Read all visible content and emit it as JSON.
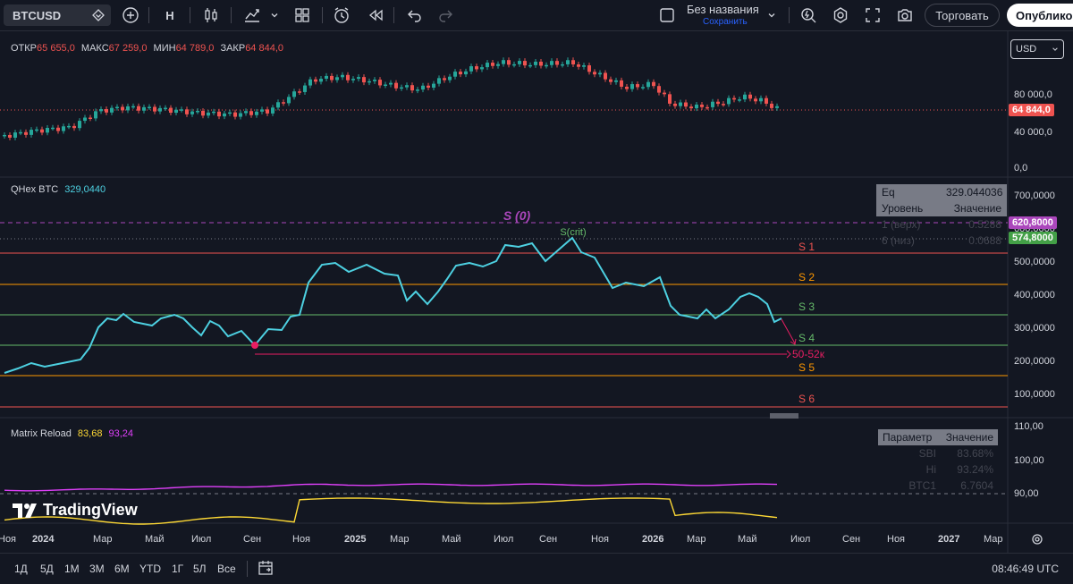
{
  "toolbar": {
    "symbol": "BTCUSD",
    "interval": "H",
    "title": "Без названия",
    "subtitle": "Сохранить",
    "trade_label": "Торговать",
    "publish_label": "Опубликовать"
  },
  "ohlc": {
    "o_label": "ОТКР",
    "o_value": "65 655,0",
    "h_label": "МАКС",
    "h_value": "67 259,0",
    "l_label": "МИН",
    "l_value": "64 789,0",
    "c_label": "ЗАКР",
    "c_value": "64 844,0"
  },
  "currency": "USD",
  "price_axis": {
    "p1": "80 000,0",
    "p2": "40 000,0",
    "p3": "0,0",
    "last_price": "64 844,0"
  },
  "qhex": {
    "name": "QHex BTC",
    "value": "329,0440",
    "axis": [
      "700,0000",
      "600,0000",
      "500,0000",
      "400,0000",
      "300,0000",
      "200,0000",
      "100,0000"
    ],
    "tag1": "620,8000",
    "tag2": "574,8000",
    "table": {
      "eq_label": "Eq",
      "eq_value": "329.044036",
      "level_h": "Уровень",
      "value_h": "Значение",
      "r1_label": "1 (верх)",
      "r1_value": "0.5288",
      "r2_label": "6 (низ)",
      "r2_value": "0.0688"
    },
    "levels": {
      "s0": "S (0)",
      "scrit": "S(crit)",
      "s1": "S 1",
      "s2": "S 2",
      "s3": "S 3",
      "s4": "S 4",
      "s5": "S 5",
      "s6": "S 6",
      "target": "50-52к"
    }
  },
  "matrix": {
    "name": "Matrix Reload",
    "v1": "83,68",
    "v2": "93,24",
    "axis": [
      "110,00",
      "100,00",
      "90,00"
    ],
    "table": {
      "param_h": "Параметр",
      "value_h": "Значение",
      "r1_label": "SBI",
      "r1_value": "83.68%",
      "r2_label": "Hi",
      "r2_value": "93.24%",
      "r3_label": "BTC1",
      "r3_value": "6.7604"
    }
  },
  "brand": "TradingView",
  "time_axis": [
    "Ноя",
    "2024",
    "Мар",
    "Май",
    "Июл",
    "Сен",
    "Ноя",
    "2025",
    "Мар",
    "Май",
    "Июл",
    "Сен",
    "Ноя",
    "2026",
    "Мар",
    "Май",
    "Июл",
    "Сен",
    "Ноя",
    "2027",
    "Мар"
  ],
  "ranges": [
    "1Д",
    "5Д",
    "1М",
    "3М",
    "6М",
    "YTD",
    "1Г",
    "5Л",
    "Все"
  ],
  "clock": "08:46:49 UTC",
  "colors": {
    "bg": "#131722",
    "up": "#26a69a",
    "down": "#ef5350",
    "qhex_line": "#4dd0e1",
    "s0": "#ab47bc",
    "purple": "#e040fb",
    "yellow": "#fdd835"
  }
}
